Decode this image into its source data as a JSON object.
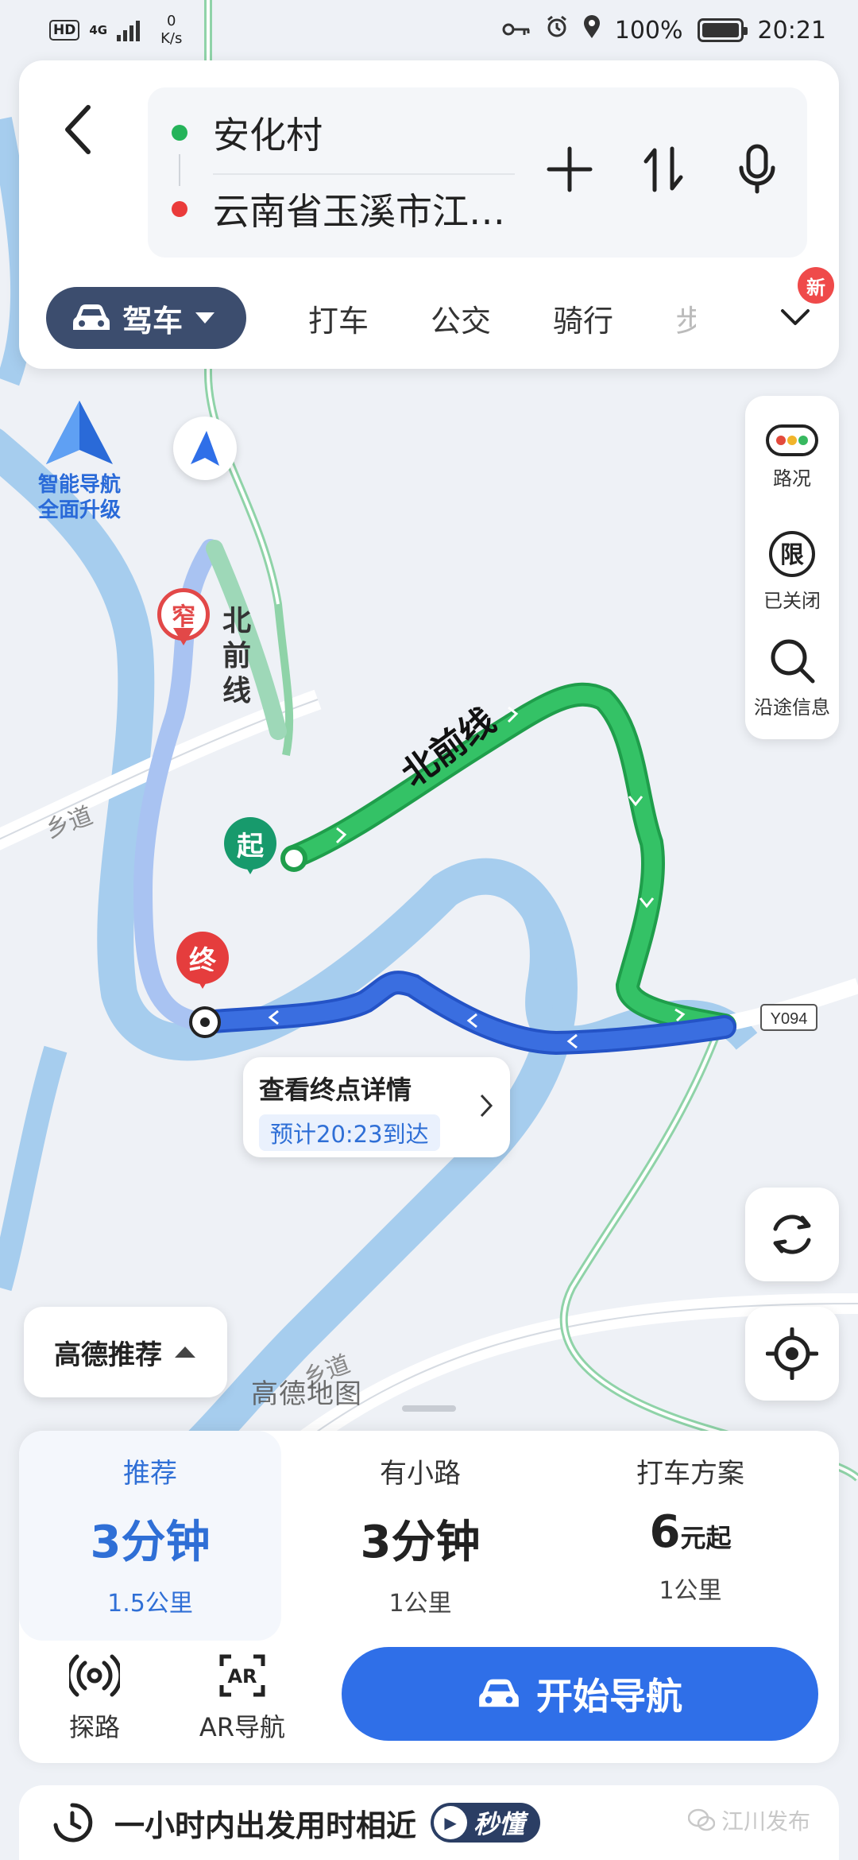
{
  "status_bar": {
    "hd": "HD",
    "net": "4G",
    "speed_value": "0",
    "speed_unit": "K/s",
    "battery": "100%",
    "time": "20:21"
  },
  "route": {
    "from": "安化村",
    "to": "云南省玉溪市江…"
  },
  "modes": {
    "active": "驾车",
    "items": [
      "打车",
      "公交",
      "骑行"
    ],
    "cut": "步",
    "new_badge": "新"
  },
  "side_tools": {
    "traffic": "路况",
    "restriction_icon": "限",
    "restriction": "已关闭",
    "along": "沿途信息"
  },
  "map": {
    "smart_nav_line1": "智能导航",
    "smart_nav_line2": "全面升级",
    "narrow_marker": "窄",
    "start_marker": "起",
    "end_marker": "终",
    "road_label_1": "北前线",
    "road_label_2": "北前线",
    "road_label_3": "乡道",
    "road_label_4": "乡道",
    "road_code": "Y094",
    "watermark": "高德地图",
    "recommend": "高德推荐"
  },
  "destination": {
    "title": "查看终点详情",
    "eta": "预计20:23到达"
  },
  "options": [
    {
      "label": "推荐",
      "time_num": "3",
      "time_unit": "分钟",
      "dist": "1.5公里",
      "active": true
    },
    {
      "label": "有小路",
      "time_num": "3",
      "time_unit": "分钟",
      "dist": "1公里",
      "active": false
    },
    {
      "label": "打车方案",
      "time_num": "6",
      "time_unit": "元起",
      "dist": "1公里",
      "active": false
    }
  ],
  "actions": {
    "explore": "探路",
    "ar_icon": "AR",
    "ar_nav": "AR导航",
    "start": "开始导航"
  },
  "footer": {
    "tip": "一小时内出发用时相近",
    "tag": "秒懂",
    "wechat": "江川发布"
  },
  "colors": {
    "accent_blue": "#2f6fe8",
    "route_green": "#27b35a",
    "route_blue": "#3a6ee0",
    "alt_route": "#a9c3f2",
    "river": "#a6cdee",
    "active_mode": "#3c4d6e"
  },
  "icons": [
    "back-arrow-icon",
    "plus-icon",
    "swap-icon",
    "microphone-icon",
    "car-icon",
    "chevron-down-icon",
    "traffic-light-icon",
    "restriction-icon",
    "search-icon",
    "refresh-icon",
    "locate-icon",
    "explore-icon",
    "ar-icon",
    "clock-icon",
    "play-icon",
    "wechat-icon"
  ]
}
